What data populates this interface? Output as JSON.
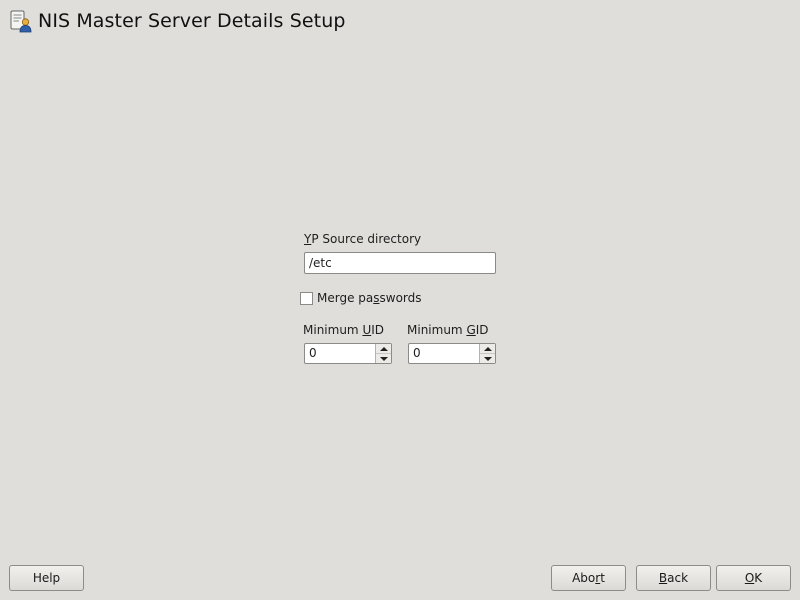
{
  "header": {
    "title": "NIS Master Server Details Setup",
    "icon": "server-config-icon"
  },
  "form": {
    "yp_source": {
      "label_pre": "",
      "label_mnemonic": "Y",
      "label_post": "P Source directory",
      "value": "/etc"
    },
    "merge_passwords": {
      "label_pre": "Merge pa",
      "label_mnemonic": "s",
      "label_post": "swords",
      "checked": false
    },
    "min_uid": {
      "label_pre": "Minimum ",
      "label_mnemonic": "U",
      "label_post": "ID",
      "value": "0"
    },
    "min_gid": {
      "label_pre": "Minimum ",
      "label_mnemonic": "G",
      "label_post": "ID",
      "value": "0"
    }
  },
  "buttons": {
    "help": {
      "label": "Help"
    },
    "abort": {
      "pre": "Abo",
      "mnemonic": "r",
      "post": "t"
    },
    "back": {
      "pre": "",
      "mnemonic": "B",
      "post": "ack"
    },
    "ok": {
      "pre": "",
      "mnemonic": "O",
      "post": "K"
    }
  }
}
